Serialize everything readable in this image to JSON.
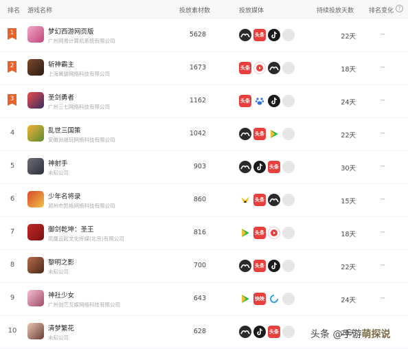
{
  "header": {
    "rank": "排名",
    "game_name": "游戏名称",
    "materials": "投放素材数",
    "media": "投放媒体",
    "days": "持续投放天数",
    "rank_change": "排名变化"
  },
  "rows": [
    {
      "rank": "1",
      "flag": true,
      "name": "梦幻西游网页版",
      "company": "广州网易计算机系统有限公司",
      "count": "5628",
      "days": "22天",
      "change": "--",
      "icon_colors": [
        "#f0a8c9",
        "#c1467a"
      ],
      "media": [
        "wuba-icon",
        "toutiao-icon",
        "douyin-icon",
        "gray-icon"
      ]
    },
    {
      "rank": "2",
      "flag": true,
      "name": "斩神霸主",
      "company": "上海冀骏网络科技有限公司",
      "count": "1673",
      "days": "18天",
      "change": "--",
      "icon_colors": [
        "#7a4a2c",
        "#2b1a12"
      ],
      "media": [
        "toutiao-icon",
        "red-play-icon",
        "wuba-icon",
        "gray-icon"
      ]
    },
    {
      "rank": "3",
      "flag": true,
      "name": "圣剑勇者",
      "company": "广州三七网络科技有限公司",
      "count": "1162",
      "days": "24天",
      "change": "--",
      "icon_colors": [
        "#e8504a",
        "#3a2a60"
      ],
      "media": [
        "toutiao-icon",
        "baidu-icon",
        "douyin-icon",
        "gray-icon"
      ]
    },
    {
      "rank": "4",
      "flag": false,
      "name": "乱世三国策",
      "company": "安徽尚晟玩网络科技有限公司",
      "count": "1042",
      "days": "22天",
      "change": "--",
      "icon_colors": [
        "#f2b23a",
        "#5a8a2e"
      ],
      "media": [
        "wuba-icon",
        "toutiao-icon",
        "green-play-icon",
        "gray-icon"
      ]
    },
    {
      "rank": "5",
      "flag": false,
      "name": "神射手",
      "company": "未知公司",
      "count": "903",
      "days": "30天",
      "change": "--",
      "icon_colors": [
        "#6c6f7a",
        "#2c2f3a"
      ],
      "media": [
        "wuba-icon",
        "douyin-icon",
        "toutiao-icon",
        "gray-icon"
      ]
    },
    {
      "rank": "6",
      "flag": false,
      "name": "少年名将录",
      "company": "郑州市凯格网络科技有限公司",
      "count": "860",
      "days": "15天",
      "change": "--",
      "icon_colors": [
        "#d64a2a",
        "#f2c04a"
      ],
      "media": [
        "bird-icon",
        "toutiao-icon",
        "wuba-icon",
        "gray-icon"
      ]
    },
    {
      "rank": "7",
      "flag": false,
      "name": "御剑乾坤：圣王",
      "company": "凤凰云起文化传媒(北京)有限公司",
      "count": "816",
      "days": "18天",
      "change": "--",
      "icon_colors": [
        "#c42a2a",
        "#7a1010"
      ],
      "media": [
        "green-play-icon",
        "toutiao-icon",
        "red-play-icon",
        "gray-icon"
      ]
    },
    {
      "rank": "8",
      "flag": false,
      "name": "黎明之影",
      "company": "未知公司",
      "count": "700",
      "days": "22天",
      "change": "--",
      "icon_colors": [
        "#b86a4a",
        "#4a2a1a"
      ],
      "media": [
        "wuba-icon",
        "toutiao-icon",
        "douyin-icon",
        "gray-icon"
      ]
    },
    {
      "rank": "9",
      "flag": false,
      "name": "神社少女",
      "company": "广州创艺互娱网络科技有限公司",
      "count": "643",
      "days": "24天",
      "change": "--",
      "icon_colors": [
        "#f4c0d0",
        "#a04a6a"
      ],
      "media": [
        "green-play-icon",
        "kuaishou-icon",
        "blue-ring-icon",
        "gray-icon"
      ]
    },
    {
      "rank": "10",
      "flag": false,
      "name": "清梦繁花",
      "company": "未知公司",
      "count": "628",
      "days": "20天",
      "change": "--",
      "icon_colors": [
        "#e8c8b0",
        "#6a3a3a"
      ],
      "media": [
        "wuba-icon",
        "douyin-icon",
        "toutiao-icon",
        "gray-icon"
      ]
    }
  ],
  "media_labels": {
    "toutiao": "头条",
    "kuaishou": "快映"
  },
  "colors": {
    "flag": "#e8622c",
    "toutiao": "#e8403c",
    "douyin": "#1a1a1a",
    "wuba": "#2a2a2a",
    "green_play": "#28b84a",
    "red_play": "#e8403c",
    "baidu": "#2f6fe0",
    "gray": "#e6e6e6"
  },
  "watermark": {
    "prefix": "头条 @手游",
    "brand": "萌探说"
  }
}
